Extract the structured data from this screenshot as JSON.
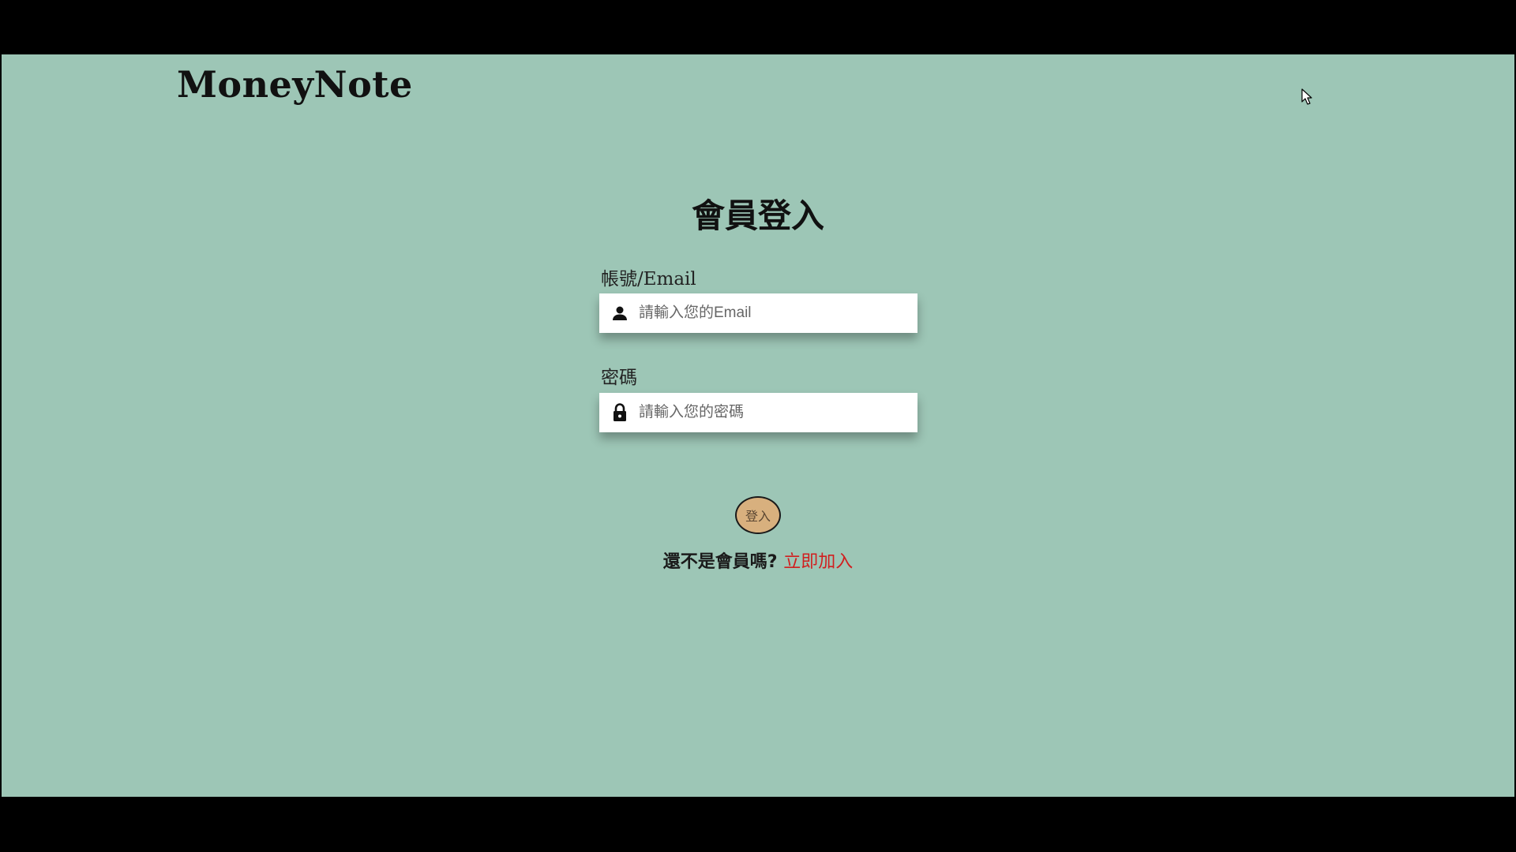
{
  "header": {
    "brand": "MoneyNote"
  },
  "login": {
    "title": "會員登入",
    "email_label": "帳號/Email",
    "email_placeholder": "請輸入您的Email",
    "email_value": "",
    "email_icon": "user-icon",
    "password_label": "密碼",
    "password_placeholder": "請輸入您的密碼",
    "password_value": "",
    "password_icon": "lock-icon",
    "submit_label": "登入",
    "signup_prompt": "還不是會員嗎?",
    "signup_link": "立即加入"
  },
  "colors": {
    "background": "#9dc6b6",
    "button": "#d8b07e",
    "link": "#d11f1f"
  }
}
